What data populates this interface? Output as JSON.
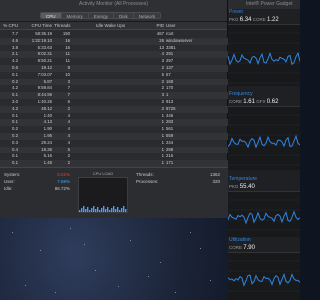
{
  "activity_monitor": {
    "title": "Activity Monitor (All Processes)",
    "tabs": [
      {
        "label": "CPU",
        "active": true
      },
      {
        "label": "Memory",
        "active": false
      },
      {
        "label": "Energy",
        "active": false
      },
      {
        "label": "Disk",
        "active": false
      },
      {
        "label": "Network",
        "active": false
      }
    ],
    "columns": [
      "% CPU",
      "CPU Time",
      "Threads",
      "Idle Wake Ups",
      "PID",
      "User"
    ],
    "rows": [
      [
        "7.7",
        "58:36.19",
        "150",
        "",
        "467",
        "root"
      ],
      [
        "4.6",
        "1:32:19.10",
        "16",
        "",
        "26",
        "windowserver"
      ],
      [
        "3.8",
        "5:33.63",
        "16",
        "",
        "13",
        "3381"
      ],
      [
        "2.1",
        "9:02.31",
        "11",
        "",
        "4",
        "291"
      ],
      [
        "4.2",
        "9:50.21",
        "11",
        "",
        "3",
        "297"
      ],
      [
        "0.6",
        "19.12",
        "8",
        "",
        "2",
        "137"
      ],
      [
        "0.1",
        "7:03.07",
        "10",
        "",
        "5",
        "57"
      ],
      [
        "0.2",
        "5.87",
        "3",
        "",
        "2",
        "168"
      ],
      [
        "4.2",
        "9:59.84",
        "7",
        "",
        "2",
        "170"
      ],
      [
        "0.1",
        "8:44.96",
        "7",
        "",
        "3",
        "1"
      ],
      [
        "3.0",
        "1:40.25",
        "6",
        "",
        "2",
        "913"
      ],
      [
        "4.2",
        "48.12",
        "2",
        "",
        "2",
        "8725"
      ],
      [
        "0.1",
        "1:40",
        "4",
        "",
        "1",
        "446"
      ],
      [
        "0.1",
        "4.13",
        "4",
        "",
        "1",
        "283"
      ],
      [
        "0.2",
        "1.90",
        "4",
        "",
        "1",
        "561"
      ],
      [
        "0.2",
        "1.95",
        "4",
        "",
        "1",
        "559"
      ],
      [
        "0.3",
        "29.24",
        "4",
        "",
        "1",
        "244"
      ],
      [
        "0.4",
        "18.36",
        "5",
        "",
        "1",
        "298"
      ],
      [
        "0.1",
        "5.16",
        "2",
        "",
        "1",
        "216"
      ],
      [
        "0.1",
        "1.45",
        "2",
        "",
        "1",
        "171"
      ],
      [
        "0.0",
        "1:34.52",
        "7",
        "",
        "1",
        "1363"
      ],
      [
        "0.0",
        "0.64",
        "3",
        "",
        "1",
        "4538"
      ],
      [
        "0.0",
        "0.66",
        "3",
        "",
        "1",
        "1521"
      ]
    ],
    "summary": {
      "rows": [
        {
          "label": "System:",
          "value": "5.51%",
          "color": "#e0403a"
        },
        {
          "label": "User:",
          "value": "7.69%",
          "color": "#4aa0ff"
        },
        {
          "label": "Idle:",
          "value": "86.72%",
          "color": "#c8c8cb"
        }
      ],
      "load_label": "CPU LOAD",
      "counts": [
        {
          "label": "Threads:",
          "value": "1362"
        },
        {
          "label": "Processes:",
          "value": "320"
        }
      ]
    }
  },
  "power_gadget": {
    "title": "Intel® Power Gadget",
    "sections": [
      {
        "title": "Power",
        "reading": [
          {
            "lbl": "PKG",
            "big": "6.34"
          },
          {
            "lbl": "CORE",
            "big": "1.22"
          }
        ],
        "line_color": "#2f86e6"
      },
      {
        "title": "Frequency",
        "reading": [
          {
            "lbl": "CORE",
            "big": "1.61"
          },
          {
            "lbl": "GFX",
            "big": "0.62"
          }
        ],
        "line_color": "#2f86e6"
      },
      {
        "title": "Temperature",
        "reading": [
          {
            "lbl": "PKG",
            "big": "55.40"
          }
        ],
        "line_color": "#2f86e6"
      },
      {
        "title": "Utilization",
        "reading": [
          {
            "lbl": "CORE",
            "big": "7.90"
          }
        ],
        "line_color": "#2f86e6"
      }
    ]
  }
}
